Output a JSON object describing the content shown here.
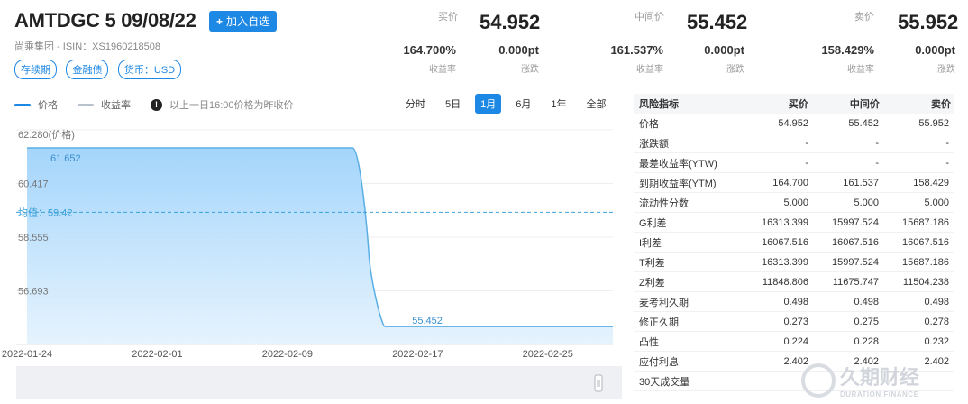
{
  "header": {
    "title": "AMTDGC 5 09/08/22",
    "watch_label": "加入自选",
    "issuer_line": "尚乘集团 - ISIN：XS1960218508",
    "tags": [
      "存续期",
      "金融债",
      "货币：USD"
    ]
  },
  "quotes": [
    {
      "label": "买价",
      "price": "54.952",
      "yield": "164.700%",
      "yield_label": "收益率",
      "change": "0.000pt",
      "change_label": "涨跌"
    },
    {
      "label": "中间价",
      "price": "55.452",
      "yield": "161.537%",
      "yield_label": "收益率",
      "change": "0.000pt",
      "change_label": "涨跌"
    },
    {
      "label": "卖价",
      "price": "55.952",
      "yield": "158.429%",
      "yield_label": "收益率",
      "change": "0.000pt",
      "change_label": "涨跌"
    }
  ],
  "legend": {
    "price": "价格",
    "yield": "收益率",
    "note": "以上一日16:00价格为昨收价"
  },
  "ranges": [
    "分时",
    "5日",
    "1月",
    "6月",
    "1年",
    "全部"
  ],
  "active_range": "1月",
  "chart": {
    "y_labels": [
      "62.280(价格)",
      "60.417",
      "58.555",
      "56.693"
    ],
    "x_labels": [
      "2022-01-24",
      "2022-02-01",
      "2022-02-09",
      "2022-02-17",
      "2022-02-25"
    ],
    "start_label": "61.652",
    "end_label": "55.452",
    "avg_label": "均值：59.42",
    "colors": {
      "line": "#5aaee6",
      "fill_top": "#9fd3fb",
      "avg": "#3aa0d8"
    }
  },
  "chart_data": {
    "type": "area",
    "x": [
      "2022-01-24",
      "2022-02-13",
      "2022-02-14",
      "2022-02-15",
      "2022-03-01"
    ],
    "values": [
      61.652,
      61.652,
      58.0,
      55.452,
      55.452
    ],
    "x_tick_labels": [
      "2022-01-24",
      "2022-02-01",
      "2022-02-09",
      "2022-02-17",
      "2022-02-25"
    ],
    "y_tick_labels": [
      "62.280(价格)",
      "60.417",
      "58.555",
      "56.693"
    ],
    "xlim": [
      "2022-01-24",
      "2022-03-01"
    ],
    "ylim": [
      54.83,
      62.28
    ],
    "average": 59.42,
    "grid": true
  },
  "table": {
    "headers": [
      "风险指标",
      "买价",
      "中间价",
      "卖价"
    ],
    "rows": [
      [
        "价格",
        "54.952",
        "55.452",
        "55.952"
      ],
      [
        "涨跌额",
        "-",
        "-",
        "-"
      ],
      [
        "最差收益率(YTW)",
        "-",
        "-",
        "-"
      ],
      [
        "到期收益率(YTM)",
        "164.700",
        "161.537",
        "158.429"
      ],
      [
        "流动性分数",
        "5.000",
        "5.000",
        "5.000"
      ],
      [
        "G利差",
        "16313.399",
        "15997.524",
        "15687.186"
      ],
      [
        "I利差",
        "16067.516",
        "16067.516",
        "16067.516"
      ],
      [
        "T利差",
        "16313.399",
        "15997.524",
        "15687.186"
      ],
      [
        "Z利差",
        "11848.806",
        "11675.747",
        "11504.238"
      ],
      [
        "麦考利久期",
        "0.498",
        "0.498",
        "0.498"
      ],
      [
        "修正久期",
        "0.273",
        "0.275",
        "0.278"
      ],
      [
        "凸性",
        "0.224",
        "0.228",
        "0.232"
      ],
      [
        "应付利息",
        "2.402",
        "2.402",
        "2.402"
      ],
      [
        "30天成交量",
        "",
        "",
        ""
      ]
    ]
  },
  "watermark": {
    "cn": "久期财经",
    "en": "DURATION FINANCE"
  }
}
